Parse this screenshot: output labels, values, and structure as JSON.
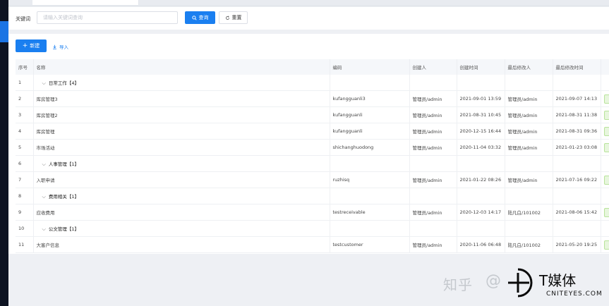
{
  "search": {
    "keyword_label": "关键词",
    "keyword_placeholder": "请输入关键词查询",
    "keyword_value": "",
    "query_label": "查询",
    "reset_label": "重置"
  },
  "toolbar": {
    "add_label": "新建",
    "import_label": "导入"
  },
  "columns": [
    "序号",
    "名称",
    "编码",
    "创建人",
    "创建时间",
    "最后修改人",
    "最后修改时间",
    ""
  ],
  "rows": [
    {
      "index": "1",
      "type": "group",
      "name": "日常工作【4】",
      "code": "",
      "creator": "",
      "created": "",
      "modifier": "",
      "modified": ""
    },
    {
      "index": "2",
      "type": "item",
      "name": "库房管理3",
      "code": "kufangguanli3",
      "creator": "管理员/admin",
      "created": "2021-09-01 13:59",
      "modifier": "管理员/admin",
      "modified": "2021-09-07 14:13"
    },
    {
      "index": "3",
      "type": "item",
      "name": "库房管理2",
      "code": "kufangguanli",
      "creator": "管理员/admin",
      "created": "2021-08-31 10:45",
      "modifier": "管理员/admin",
      "modified": "2021-08-31 11:38"
    },
    {
      "index": "4",
      "type": "item",
      "name": "库房管理",
      "code": "kufangguanli",
      "creator": "管理员/admin",
      "created": "2020-12-15 16:44",
      "modifier": "管理员/admin",
      "modified": "2021-08-31 09:36"
    },
    {
      "index": "5",
      "type": "item",
      "name": "市场活动",
      "code": "shichanghuodong",
      "creator": "管理员/admin",
      "created": "2020-11-04 03:32",
      "modifier": "管理员/admin",
      "modified": "2021-01-23 03:08"
    },
    {
      "index": "6",
      "type": "group",
      "name": "人事管理【1】",
      "code": "",
      "creator": "",
      "created": "",
      "modifier": "",
      "modified": ""
    },
    {
      "index": "7",
      "type": "item",
      "name": "入职申请",
      "code": "ruzhisq",
      "creator": "管理员/admin",
      "created": "2021-01-22 08:26",
      "modifier": "管理员/admin",
      "modified": "2021-07-16 09:22"
    },
    {
      "index": "8",
      "type": "group",
      "name": "费用相关【1】",
      "code": "",
      "creator": "",
      "created": "",
      "modifier": "",
      "modified": ""
    },
    {
      "index": "9",
      "type": "item",
      "name": "应收费用",
      "code": "testreceivable",
      "creator": "管理员/admin",
      "created": "2020-12-03 14:17",
      "modifier": "陆凡白/101002",
      "modified": "2021-08-06 15:42"
    },
    {
      "index": "10",
      "type": "group",
      "name": "公文管理【1】",
      "code": "",
      "creator": "",
      "created": "",
      "modifier": "",
      "modified": ""
    },
    {
      "index": "11",
      "type": "item",
      "name": "大客户信息",
      "code": "testcustomer",
      "creator": "管理员/admin",
      "created": "2020-11-06 06:48",
      "modifier": "陆凡白/101002",
      "modified": "2021-05-20 19:25"
    }
  ],
  "watermark": {
    "zhihu": "知乎",
    "at": "@",
    "brand": "T媒体",
    "sub": "CNITEYES.COM"
  },
  "colors": {
    "primary": "#1a7ff0",
    "sidebar": "#0d1322",
    "status_fill": "#e7f6dd"
  }
}
